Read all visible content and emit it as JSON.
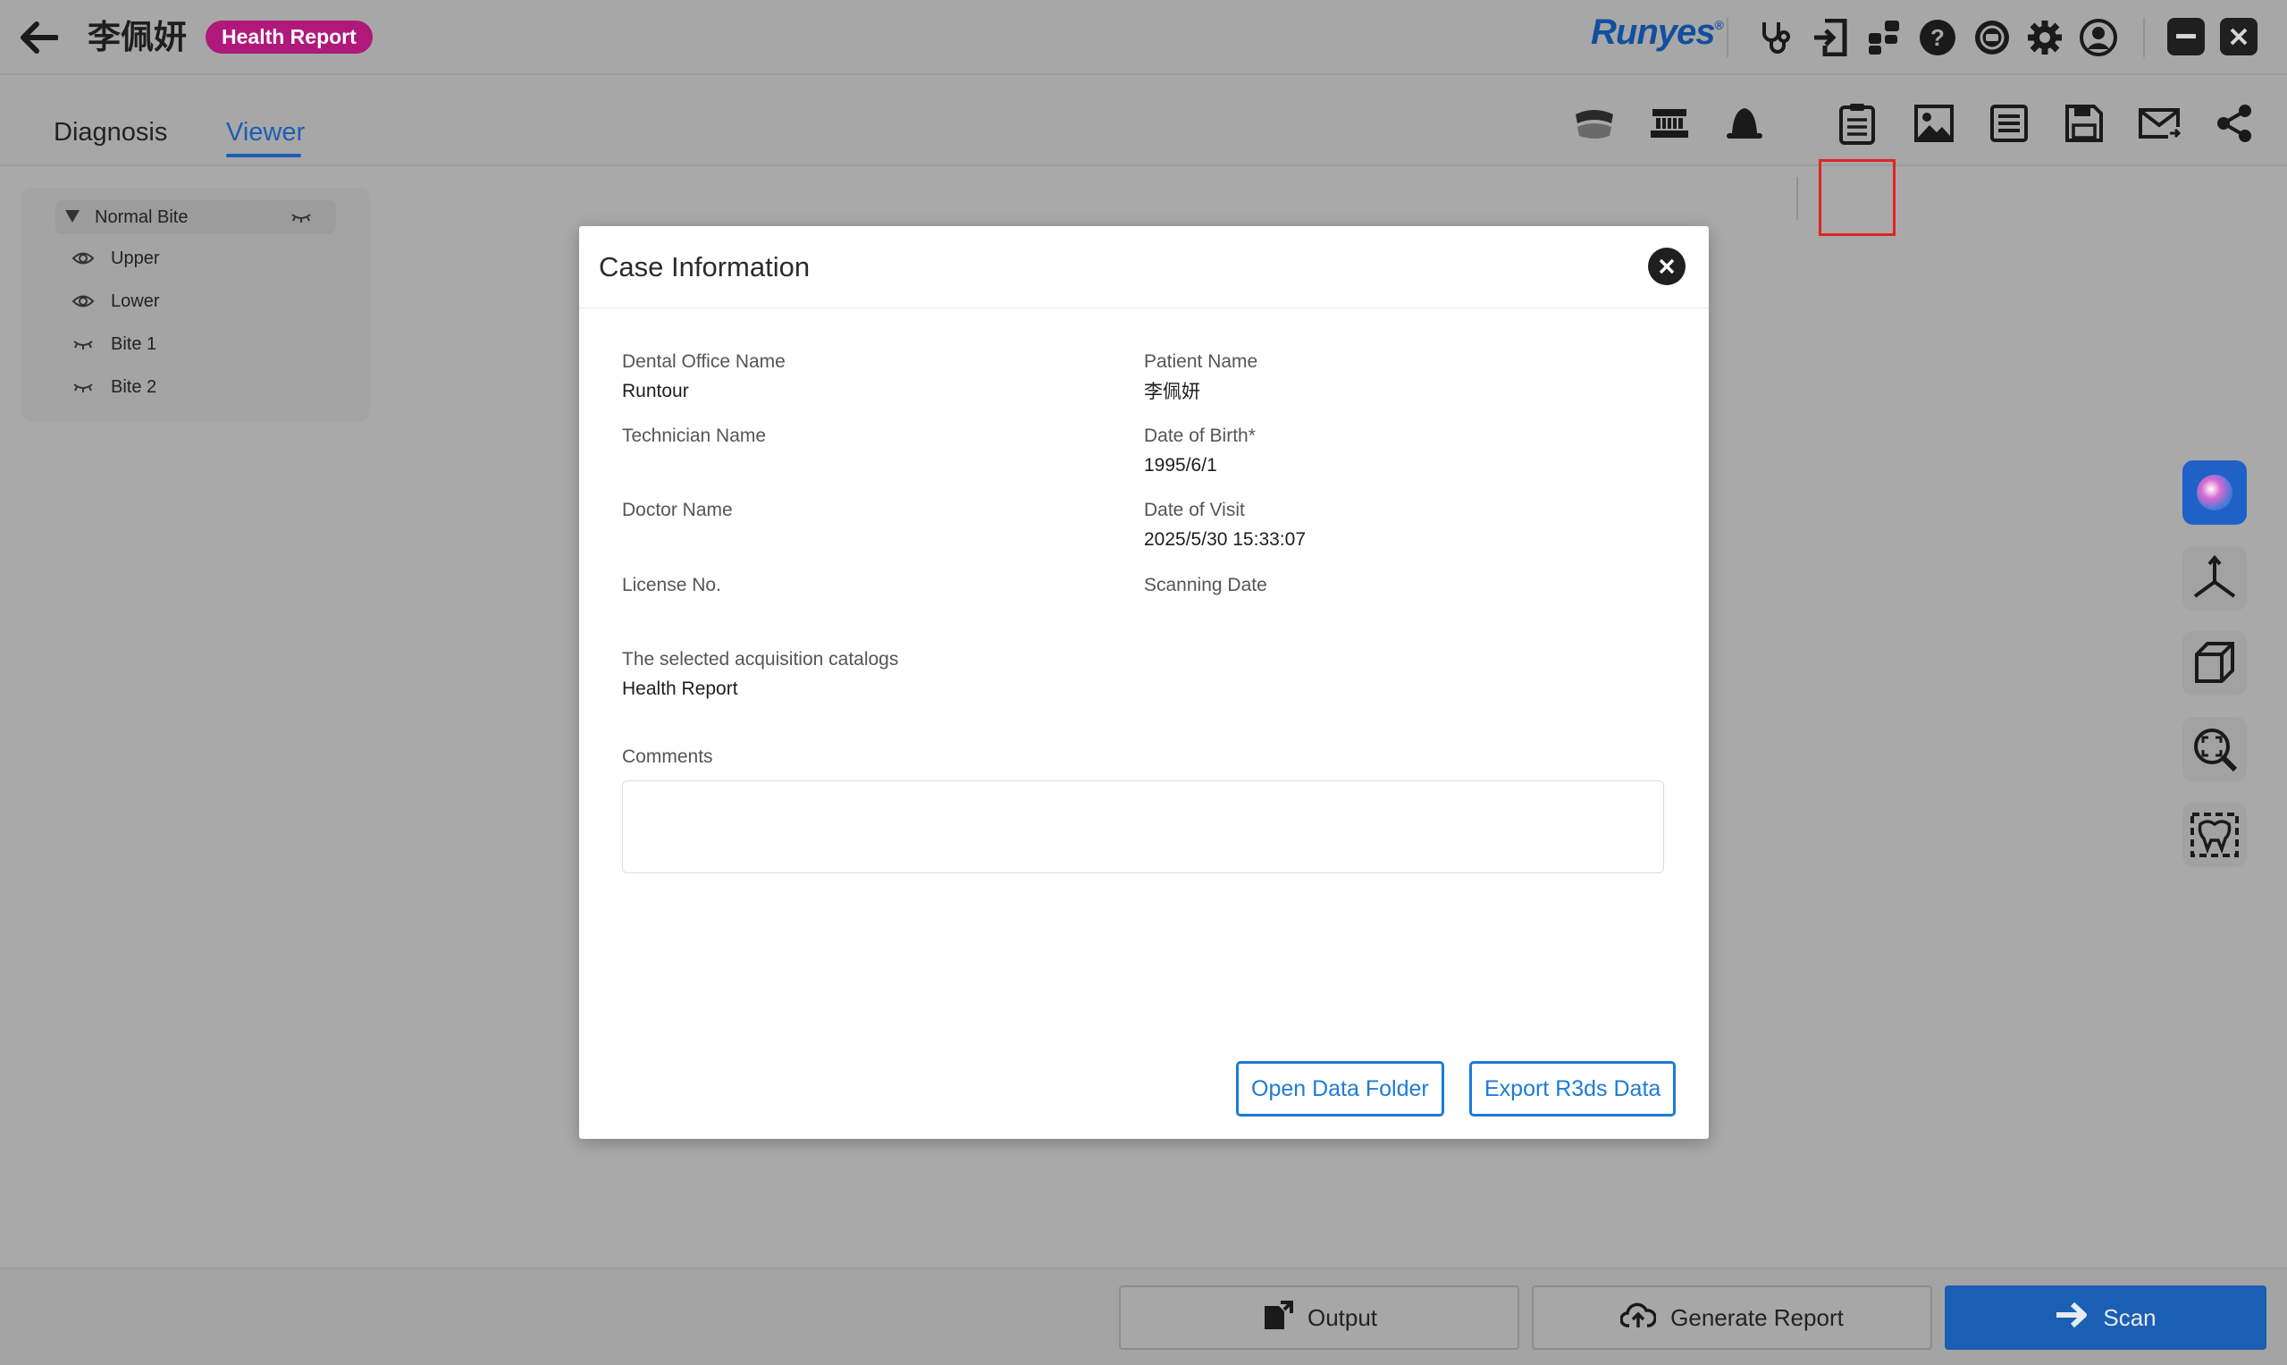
{
  "titlebar": {
    "patient_name": "李佩妍",
    "badge": "Health Report",
    "brand": "Runyes",
    "brand_mark": "®",
    "icons": [
      "stethoscope-icon",
      "import-icon",
      "apps-icon",
      "help-icon",
      "remote-support-icon",
      "settings-icon",
      "account-icon"
    ]
  },
  "tabs": [
    {
      "label": "Diagnosis",
      "active": false
    },
    {
      "label": "Viewer",
      "active": true
    }
  ],
  "toolbar_tools": [
    "jaw-model-icon",
    "arch-icon",
    "bell-icon",
    "case-info-icon",
    "image-icon",
    "list-icon",
    "save-icon",
    "mail-icon",
    "share-icon"
  ],
  "tree": {
    "group": "Normal Bite",
    "items": [
      {
        "label": "Upper",
        "icon": "eye-icon"
      },
      {
        "label": "Lower",
        "icon": "eye-icon"
      },
      {
        "label": "Bite 1",
        "icon": "eye-closed-icon"
      },
      {
        "label": "Bite 2",
        "icon": "eye-closed-icon"
      }
    ]
  },
  "side_tools": [
    "color-icon",
    "axis-icon",
    "cube-view-icon",
    "zoom-fit-icon",
    "teeth-select-icon"
  ],
  "modal": {
    "title": "Case Information",
    "fields": {
      "dental_office_label": "Dental Office Name",
      "dental_office_value": "Runtour",
      "patient_name_label": "Patient Name",
      "patient_name_value": "李佩妍",
      "technician_label": "Technician Name",
      "technician_value": "",
      "dob_label": "Date of Birth*",
      "dob_value": "1995/6/1",
      "doctor_label": "Doctor Name",
      "doctor_value": "",
      "visit_label": "Date of Visit",
      "visit_value": "2025/5/30 15:33:07",
      "license_label": "License No.",
      "license_value": "",
      "scanning_label": "Scanning Date",
      "scanning_value": "",
      "catalogs_label": "The selected acquisition catalogs",
      "catalogs_value": "Health Report",
      "comments_label": "Comments",
      "comments_value": ""
    },
    "buttons": {
      "open_folder": "Open Data Folder",
      "export": "Export R3ds Data"
    }
  },
  "bottom": {
    "output": "Output",
    "generate": "Generate Report",
    "scan": "Scan"
  },
  "colors": {
    "accent": "#1a5fb4",
    "badge": "#b0187a",
    "highlight": "#e02424",
    "overlay_bg": "#a9a9a9"
  }
}
